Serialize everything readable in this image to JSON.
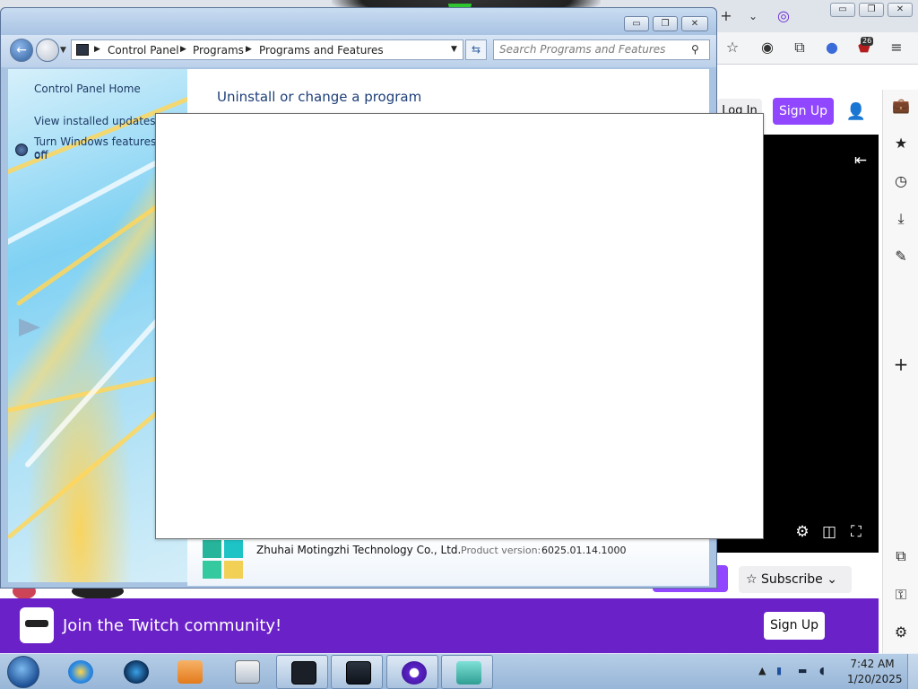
{
  "control_panel": {
    "breadcrumb": [
      "Control Panel",
      "Programs",
      "Programs and Features"
    ],
    "search_placeholder": "Search Programs and Features",
    "left_links": [
      "Control Panel Home",
      "View installed updates",
      "Turn Windows features on or",
      "off"
    ],
    "heading": "Uninstall or change a program",
    "details": {
      "publisher": "Zhuhai Motingzhi Technology Co., Ltd.",
      "version_label": "Product version:",
      "version_value": "6025.01.14.1000"
    }
  },
  "browser": {
    "extension_badge": "26",
    "login_label": "Log In",
    "signup_label": "Sign Up",
    "subscribe_label": "Subscribe",
    "join_banner_text": "Join the Twitch community!",
    "join_signup_label": "Sign Up",
    "accent_color": "#9147ff"
  },
  "taskbar": {
    "time": "7:42 AM",
    "date": "1/20/2025"
  }
}
